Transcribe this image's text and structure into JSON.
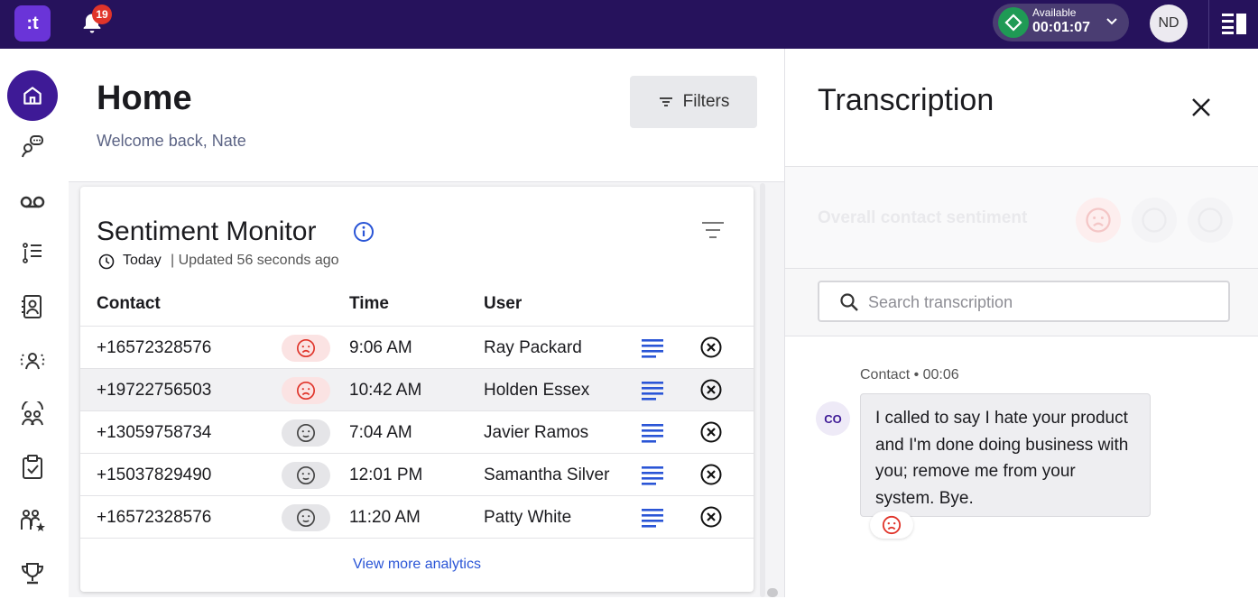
{
  "app": {
    "logo_text": ":t",
    "notifications_count": "19",
    "status": {
      "label": "Available",
      "timer": "00:01:07",
      "color": "#1f9a55"
    },
    "user_initials": "ND",
    "brand_color": "#26125c",
    "accent_color": "#3e1a96"
  },
  "nav": {
    "items": [
      {
        "icon": "home-icon",
        "active": true
      },
      {
        "icon": "conversation-icon"
      },
      {
        "icon": "voicemail-icon"
      },
      {
        "icon": "list-icon"
      },
      {
        "icon": "contact-book-icon"
      },
      {
        "icon": "live-monitor-icon"
      },
      {
        "icon": "team-icon"
      },
      {
        "icon": "clipboard-check-icon"
      },
      {
        "icon": "performance-icon"
      },
      {
        "icon": "trophy-icon"
      }
    ]
  },
  "home": {
    "title": "Home",
    "subtitle": "Welcome back, Nate",
    "filters_label": "Filters"
  },
  "sentiment": {
    "title": "Sentiment Monitor",
    "period": "Today",
    "updated": "| Updated 56 seconds ago",
    "columns": {
      "contact": "Contact",
      "time": "Time",
      "user": "User"
    },
    "rows": [
      {
        "contact": "+16572328576",
        "sentiment": "negative",
        "time": "9:06 AM",
        "user": "Ray Packard"
      },
      {
        "contact": "+19722756503",
        "sentiment": "negative",
        "time": "10:42 AM",
        "user": "Holden Essex"
      },
      {
        "contact": "+13059758734",
        "sentiment": "neutral",
        "time": "7:04 AM",
        "user": "Javier Ramos"
      },
      {
        "contact": "+15037829490",
        "sentiment": "neutral",
        "time": "12:01 PM",
        "user": "Samantha Silver"
      },
      {
        "contact": "+16572328576",
        "sentiment": "neutral",
        "time": "11:20 AM",
        "user": "Patty White"
      }
    ],
    "view_more": "View more analytics",
    "negative_color": "#e0342a",
    "link_color": "#2a55d6"
  },
  "transcription": {
    "title": "Transcription",
    "overall_label": "Overall contact sentiment",
    "search_placeholder": "Search transcription",
    "message": {
      "meta": "Contact • 00:06",
      "avatar": "CO",
      "text": "I called to say I hate your product and I'm done doing business with you; remove me from your system. Bye.",
      "sentiment": "negative"
    }
  }
}
